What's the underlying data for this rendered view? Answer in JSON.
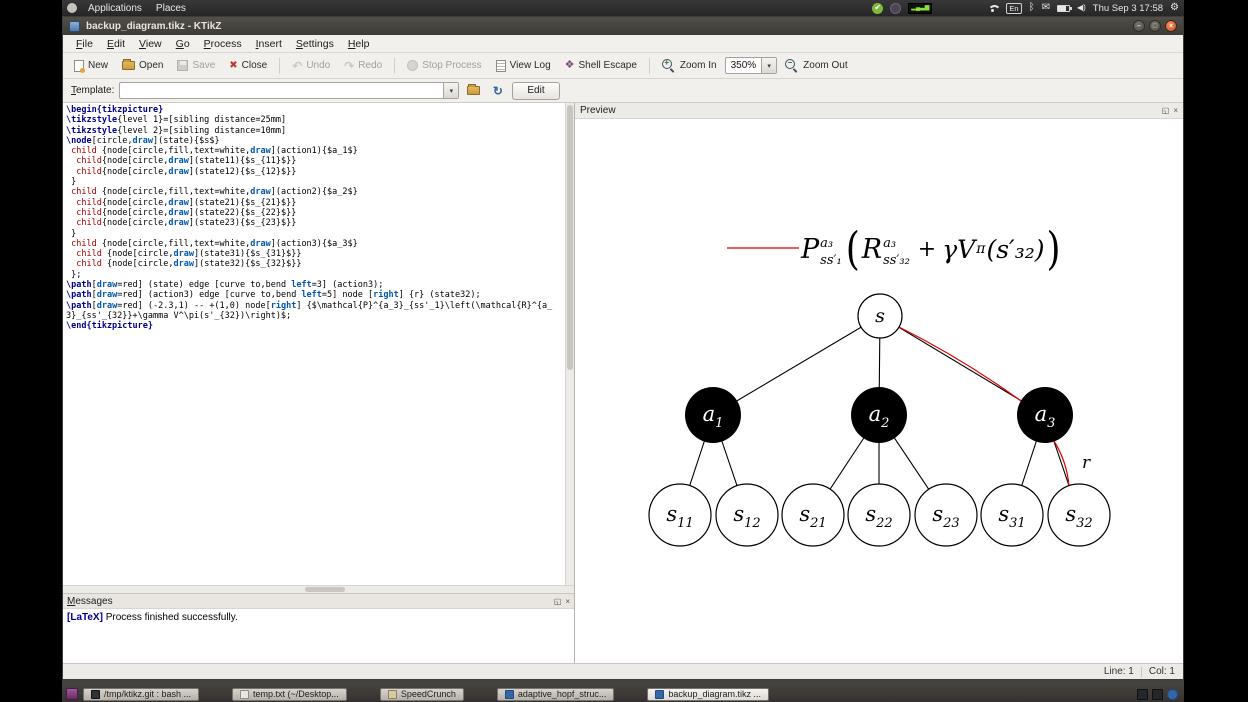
{
  "top_panel": {
    "menus": [
      {
        "label": "Applications"
      },
      {
        "label": "Places"
      }
    ],
    "keyboard_indicator": "En",
    "clock": "Thu Sep 3 17:58"
  },
  "icons": {
    "panel_check": "✔",
    "panel_graph": "▂▄▃▆",
    "panel_bt": "ᛒ",
    "panel_mail": "✉",
    "panel_volume": "◀)",
    "panel_gear": "⚙",
    "win_min": "–",
    "win_max": "□",
    "win_close": "×",
    "close_x": "✖",
    "undo_arrow": "↶",
    "redo_arrow": "↷",
    "shell_diamond": "❖",
    "combo_arrow": "▾",
    "reload": "↻",
    "mag_plus": "+",
    "mag_minus": "−",
    "detach": "◱",
    "small_close": "×"
  },
  "window": {
    "title": "backup_diagram.tikz - KTikZ",
    "menu_items": [
      {
        "label": "File"
      },
      {
        "label": "Edit"
      },
      {
        "label": "View"
      },
      {
        "label": "Go"
      },
      {
        "label": "Process"
      },
      {
        "label": "Insert"
      },
      {
        "label": "Settings"
      },
      {
        "label": "Help"
      }
    ],
    "toolbar": {
      "new": "New",
      "open": "Open",
      "save": "Save",
      "close": "Close",
      "undo": "Undo",
      "redo": "Redo",
      "stop": "Stop Process",
      "view_log": "View Log",
      "shell_escape": "Shell Escape",
      "zoom_in": "Zoom In",
      "zoom_value": "350%",
      "zoom_out": "Zoom Out"
    },
    "template_row": {
      "label": "Template:",
      "value": "",
      "edit_button": "Edit"
    },
    "statusbar": {
      "line": "Line: 1",
      "col": "Col: 1"
    }
  },
  "editor": {
    "lines": [
      [
        {
          "c": "kw",
          "t": "\\begin{tikzpicture}"
        }
      ],
      [
        {
          "c": "kw",
          "t": "\\tikzstyle"
        },
        {
          "c": "pl",
          "t": "{level 1}=[sibling distance=25mm]"
        }
      ],
      [
        {
          "c": "kw",
          "t": "\\tikzstyle"
        },
        {
          "c": "pl",
          "t": "{level 2}=[sibling distance=10mm]"
        }
      ],
      [
        {
          "c": "kw",
          "t": "\\node"
        },
        {
          "c": "pl",
          "t": "[circle,"
        },
        {
          "c": "opt",
          "t": "draw"
        },
        {
          "c": "pl",
          "t": "](state){$s$}"
        }
      ],
      [
        {
          "c": "pl",
          "t": " "
        },
        {
          "c": "ch",
          "t": "child"
        },
        {
          "c": "pl",
          "t": " {node[circle,fill,text=white,"
        },
        {
          "c": "opt",
          "t": "draw"
        },
        {
          "c": "pl",
          "t": "](action1){$a_1$}"
        }
      ],
      [
        {
          "c": "pl",
          "t": "  "
        },
        {
          "c": "ch",
          "t": "child"
        },
        {
          "c": "pl",
          "t": "{node[circle,"
        },
        {
          "c": "opt",
          "t": "draw"
        },
        {
          "c": "pl",
          "t": "](state11){$s_{11}$}}"
        }
      ],
      [
        {
          "c": "pl",
          "t": "  "
        },
        {
          "c": "ch",
          "t": "child"
        },
        {
          "c": "pl",
          "t": "{node[circle,"
        },
        {
          "c": "opt",
          "t": "draw"
        },
        {
          "c": "pl",
          "t": "](state12){$s_{12}$}}"
        }
      ],
      [
        {
          "c": "pl",
          "t": " }"
        }
      ],
      [
        {
          "c": "pl",
          "t": " "
        },
        {
          "c": "ch",
          "t": "child"
        },
        {
          "c": "pl",
          "t": " {node[circle,fill,text=white,"
        },
        {
          "c": "opt",
          "t": "draw"
        },
        {
          "c": "pl",
          "t": "](action2){$a_2$}"
        }
      ],
      [
        {
          "c": "pl",
          "t": "  "
        },
        {
          "c": "ch",
          "t": "child"
        },
        {
          "c": "pl",
          "t": "{node[circle,"
        },
        {
          "c": "opt",
          "t": "draw"
        },
        {
          "c": "pl",
          "t": "](state21){$s_{21}$}}"
        }
      ],
      [
        {
          "c": "pl",
          "t": "  "
        },
        {
          "c": "ch",
          "t": "child"
        },
        {
          "c": "pl",
          "t": "{node[circle,"
        },
        {
          "c": "opt",
          "t": "draw"
        },
        {
          "c": "pl",
          "t": "](state22){$s_{22}$}}"
        }
      ],
      [
        {
          "c": "pl",
          "t": "  "
        },
        {
          "c": "ch",
          "t": "child"
        },
        {
          "c": "pl",
          "t": "{node[circle,"
        },
        {
          "c": "opt",
          "t": "draw"
        },
        {
          "c": "pl",
          "t": "](state23){$s_{23}$}}"
        }
      ],
      [
        {
          "c": "pl",
          "t": " }"
        }
      ],
      [
        {
          "c": "pl",
          "t": " "
        },
        {
          "c": "ch",
          "t": "child"
        },
        {
          "c": "pl",
          "t": " {node[circle,fill,text=white,"
        },
        {
          "c": "opt",
          "t": "draw"
        },
        {
          "c": "pl",
          "t": "](action3){$a_3$}"
        }
      ],
      [
        {
          "c": "pl",
          "t": "  "
        },
        {
          "c": "ch",
          "t": "child"
        },
        {
          "c": "pl",
          "t": " {node[circle,"
        },
        {
          "c": "opt",
          "t": "draw"
        },
        {
          "c": "pl",
          "t": "](state31){$s_{31}$}}"
        }
      ],
      [
        {
          "c": "pl",
          "t": "  "
        },
        {
          "c": "ch",
          "t": "child"
        },
        {
          "c": "pl",
          "t": " {node[circle,"
        },
        {
          "c": "opt",
          "t": "draw"
        },
        {
          "c": "pl",
          "t": "](state32){$s_{32}$}}"
        }
      ],
      [
        {
          "c": "pl",
          "t": " };"
        }
      ],
      [
        {
          "c": "kw",
          "t": "\\path"
        },
        {
          "c": "pl",
          "t": "["
        },
        {
          "c": "opt",
          "t": "draw"
        },
        {
          "c": "pl",
          "t": "=red] (state) edge [curve to,bend "
        },
        {
          "c": "opt",
          "t": "left"
        },
        {
          "c": "pl",
          "t": "=3] (action3);"
        }
      ],
      [
        {
          "c": "kw",
          "t": "\\path"
        },
        {
          "c": "pl",
          "t": "["
        },
        {
          "c": "opt",
          "t": "draw"
        },
        {
          "c": "pl",
          "t": "=red] (action3) edge [curve to,bend "
        },
        {
          "c": "opt",
          "t": "left"
        },
        {
          "c": "pl",
          "t": "=5] node ["
        },
        {
          "c": "opt",
          "t": "right"
        },
        {
          "c": "pl",
          "t": "] {r} (state32);"
        }
      ],
      [
        {
          "c": "kw",
          "t": "\\path"
        },
        {
          "c": "pl",
          "t": "["
        },
        {
          "c": "opt",
          "t": "draw"
        },
        {
          "c": "pl",
          "t": "=red] (-2.3,1) -- +(1,0) node["
        },
        {
          "c": "opt",
          "t": "right"
        },
        {
          "c": "pl",
          "t": "] {$\\mathcal{P}^{a_3}_{ss'_1}\\left(\\mathcal{R}^{a_3}_{ss'_{32}}+\\gamma V^\\pi(s'_{32})\\right)$;"
        }
      ],
      [
        {
          "c": "kw",
          "t": "\\end{tikzpicture}"
        }
      ]
    ]
  },
  "preview": {
    "title": "Preview",
    "formula": {
      "p": "P",
      "p_sup": "a₃",
      "p_sub": "ss′₁",
      "lparen": "(",
      "r": "R",
      "r_sup": "a₃",
      "r_sub": "ss′₃₂",
      "plus": "+",
      "gamma_v": "γV",
      "pi_sup": "π",
      "tail": "(s′₃₂)",
      "rparen": ")"
    },
    "nodes": {
      "s": {
        "main": "s",
        "sub": ""
      },
      "a1": {
        "main": "a",
        "sub": "1"
      },
      "a2": {
        "main": "a",
        "sub": "2"
      },
      "a3": {
        "main": "a",
        "sub": "3"
      },
      "s11": {
        "main": "s",
        "sub": "11"
      },
      "s12": {
        "main": "s",
        "sub": "12"
      },
      "s21": {
        "main": "s",
        "sub": "21"
      },
      "s22": {
        "main": "s",
        "sub": "22"
      },
      "s23": {
        "main": "s",
        "sub": "23"
      },
      "s31": {
        "main": "s",
        "sub": "31"
      },
      "s32": {
        "main": "s",
        "sub": "32"
      },
      "reward_label": "r"
    }
  },
  "messages": {
    "title": "Messages",
    "tag": "[LaTeX]",
    "text": " Process finished successfully."
  },
  "taskbar": {
    "items": [
      {
        "label": "/tmp/ktikz.git : bash ..."
      },
      {
        "label": "temp.txt (~/Desktop..."
      },
      {
        "label": "SpeedCrunch"
      },
      {
        "label": "adaptive_hopf_struc..."
      },
      {
        "label": "backup_diagram.tikz ..."
      }
    ]
  }
}
